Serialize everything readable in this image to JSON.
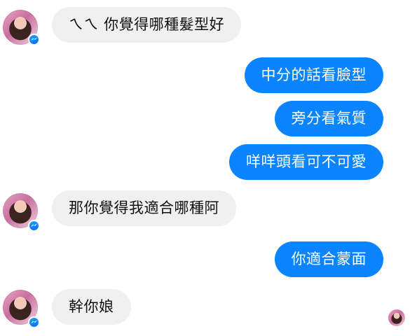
{
  "messages": {
    "m1": "ㄟㄟ 你覺得哪種髮型好",
    "m2": "中分的話看臉型",
    "m3": "旁分看氣質",
    "m4": "咩咩頭看可不可愛",
    "m5": "那你覺得我適合哪種阿",
    "m6": "你適合蒙面",
    "m7": "幹你娘"
  },
  "colors": {
    "outgoing_bubble": "#0a84ff",
    "incoming_bubble": "#f1f0f0",
    "messenger_badge": "#0a6ef2"
  },
  "icons": {
    "badge": "messenger-badge-icon"
  }
}
